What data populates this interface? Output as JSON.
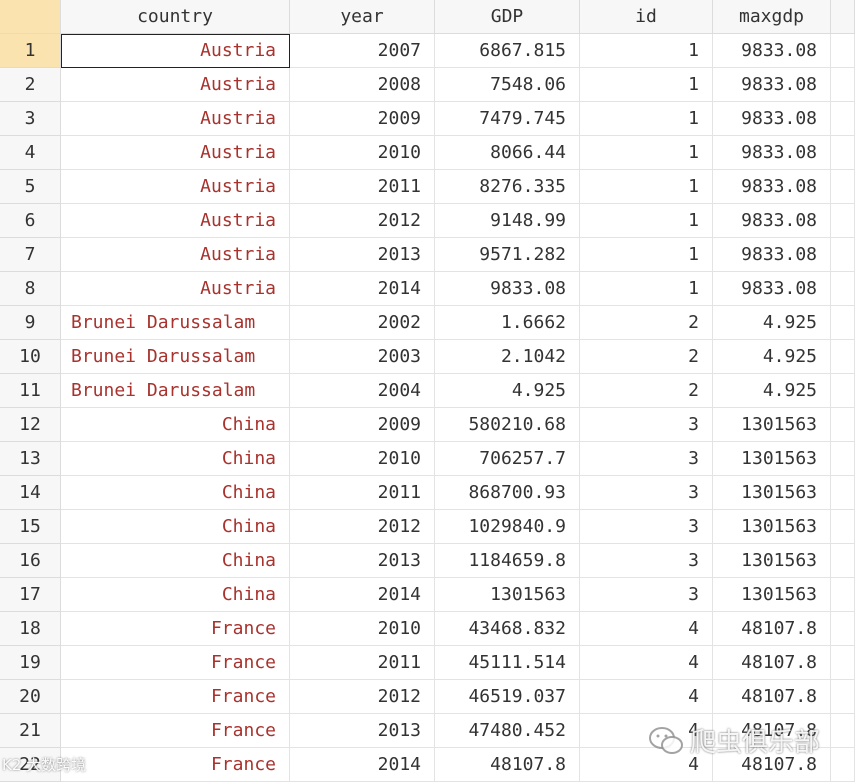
{
  "columns": [
    {
      "name": "country",
      "type": "str"
    },
    {
      "name": "year",
      "type": "num"
    },
    {
      "name": "GDP",
      "type": "num"
    },
    {
      "name": "id",
      "type": "num"
    },
    {
      "name": "maxgdp",
      "type": "num"
    }
  ],
  "rows": [
    {
      "n": "1",
      "country": "Austria",
      "year": "2007",
      "GDP": "6867.815",
      "id": "1",
      "maxgdp": "9833.08"
    },
    {
      "n": "2",
      "country": "Austria",
      "year": "2008",
      "GDP": "7548.06",
      "id": "1",
      "maxgdp": "9833.08"
    },
    {
      "n": "3",
      "country": "Austria",
      "year": "2009",
      "GDP": "7479.745",
      "id": "1",
      "maxgdp": "9833.08"
    },
    {
      "n": "4",
      "country": "Austria",
      "year": "2010",
      "GDP": "8066.44",
      "id": "1",
      "maxgdp": "9833.08"
    },
    {
      "n": "5",
      "country": "Austria",
      "year": "2011",
      "GDP": "8276.335",
      "id": "1",
      "maxgdp": "9833.08"
    },
    {
      "n": "6",
      "country": "Austria",
      "year": "2012",
      "GDP": "9148.99",
      "id": "1",
      "maxgdp": "9833.08"
    },
    {
      "n": "7",
      "country": "Austria",
      "year": "2013",
      "GDP": "9571.282",
      "id": "1",
      "maxgdp": "9833.08"
    },
    {
      "n": "8",
      "country": "Austria",
      "year": "2014",
      "GDP": "9833.08",
      "id": "1",
      "maxgdp": "9833.08"
    },
    {
      "n": "9",
      "country": "Brunei Darussalam",
      "year": "2002",
      "GDP": "1.6662",
      "id": "2",
      "maxgdp": "4.925"
    },
    {
      "n": "10",
      "country": "Brunei Darussalam",
      "year": "2003",
      "GDP": "2.1042",
      "id": "2",
      "maxgdp": "4.925"
    },
    {
      "n": "11",
      "country": "Brunei Darussalam",
      "year": "2004",
      "GDP": "4.925",
      "id": "2",
      "maxgdp": "4.925"
    },
    {
      "n": "12",
      "country": "China",
      "year": "2009",
      "GDP": "580210.68",
      "id": "3",
      "maxgdp": "1301563"
    },
    {
      "n": "13",
      "country": "China",
      "year": "2010",
      "GDP": "706257.7",
      "id": "3",
      "maxgdp": "1301563"
    },
    {
      "n": "14",
      "country": "China",
      "year": "2011",
      "GDP": "868700.93",
      "id": "3",
      "maxgdp": "1301563"
    },
    {
      "n": "15",
      "country": "China",
      "year": "2012",
      "GDP": "1029840.9",
      "id": "3",
      "maxgdp": "1301563"
    },
    {
      "n": "16",
      "country": "China",
      "year": "2013",
      "GDP": "1184659.8",
      "id": "3",
      "maxgdp": "1301563"
    },
    {
      "n": "17",
      "country": "China",
      "year": "2014",
      "GDP": "1301563",
      "id": "3",
      "maxgdp": "1301563"
    },
    {
      "n": "18",
      "country": "France",
      "year": "2010",
      "GDP": "43468.832",
      "id": "4",
      "maxgdp": "48107.8"
    },
    {
      "n": "19",
      "country": "France",
      "year": "2011",
      "GDP": "45111.514",
      "id": "4",
      "maxgdp": "48107.8"
    },
    {
      "n": "20",
      "country": "France",
      "year": "2012",
      "GDP": "46519.037",
      "id": "4",
      "maxgdp": "48107.8"
    },
    {
      "n": "21",
      "country": "France",
      "year": "2013",
      "GDP": "47480.452",
      "id": "4",
      "maxgdp": "48107.8"
    },
    {
      "n": "22",
      "country": "France",
      "year": "2014",
      "GDP": "48107.8",
      "id": "4",
      "maxgdp": "48107.8"
    }
  ],
  "selected_row": "1",
  "watermark": {
    "left": "K2 大数跨境",
    "right": "爬虫俱乐部"
  },
  "colors": {
    "string_text": "#a8322d",
    "selected_row_header": "#fbe3b0"
  }
}
